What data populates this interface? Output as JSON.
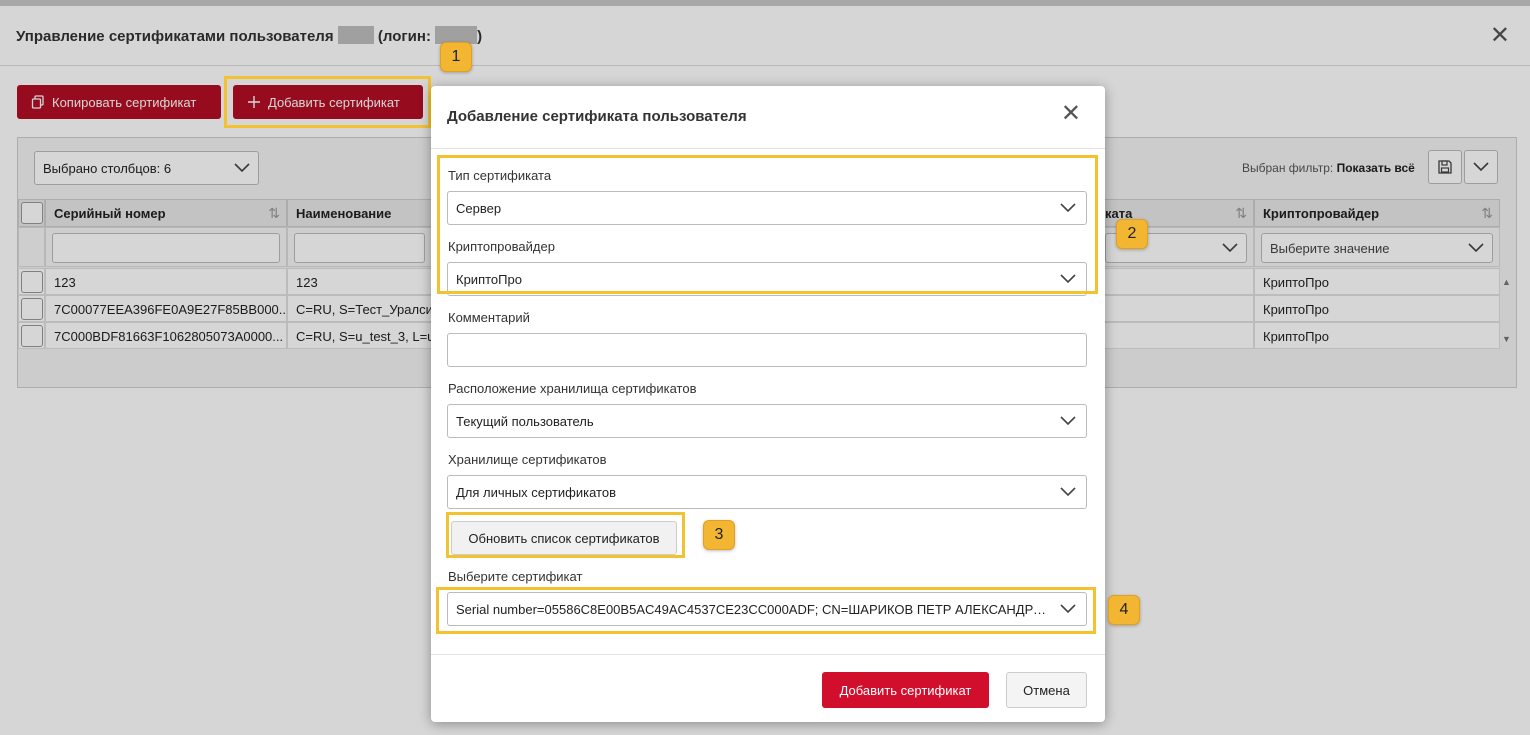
{
  "window": {
    "title_prefix": "Управление сертификатами пользователя",
    "title_login": "(логин:",
    "title_suffix": ")"
  },
  "toolbar": {
    "copy_label": "Копировать сертификат",
    "add_label": "Добавить сертификат"
  },
  "grid": {
    "columns_selected": "Выбрано столбцов: 6",
    "filter_label": "Выбран фильтр:",
    "filter_value": "Показать всё",
    "headers": {
      "serial": "Серийный номер",
      "name": "Наименование",
      "partial": "ката",
      "provider": "Криптопровайдер"
    },
    "provider_filter_placeholder": "Выберите значение",
    "rows": [
      {
        "serial": "123",
        "name": "123",
        "provider": "КриптоПро"
      },
      {
        "serial": "7C00077EEA396FE0A9E27F85BB000...",
        "name": "C=RU, S=Тест_Уралси",
        "provider": "КриптоПро"
      },
      {
        "serial": "7C000BDF81663F1062805073A0000...",
        "name": "C=RU, S=u_test_3, L=u",
        "provider": "КриптоПро"
      }
    ]
  },
  "modal": {
    "title": "Добавление сертификата пользователя",
    "cert_type_label": "Тип сертификата",
    "cert_type_value": "Сервер",
    "provider_label": "Криптопровайдер",
    "provider_value": "КриптоПро",
    "comment_label": "Комментарий",
    "comment_value": "",
    "store_location_label": "Расположение хранилища сертификатов",
    "store_location_value": "Текущий пользователь",
    "store_label": "Хранилище сертификатов",
    "store_value": "Для личных сертификатов",
    "refresh_label": "Обновить список сертификатов",
    "select_cert_label": "Выберите сертификат",
    "select_cert_value": "Serial number=05586C8E00B5AC49AC4537CE23CC000ADF; CN=ШАРИКОВ ПЕТР АЛЕКСАНДРОВИЧ",
    "submit_label": "Добавить сертификат",
    "cancel_label": "Отмена"
  },
  "badges": [
    "1",
    "2",
    "3",
    "4"
  ],
  "colors": {
    "accent_red": "#b30f24",
    "primary_red": "#d10f2c",
    "highlight": "#f2c230",
    "badge": "#f2b632"
  }
}
